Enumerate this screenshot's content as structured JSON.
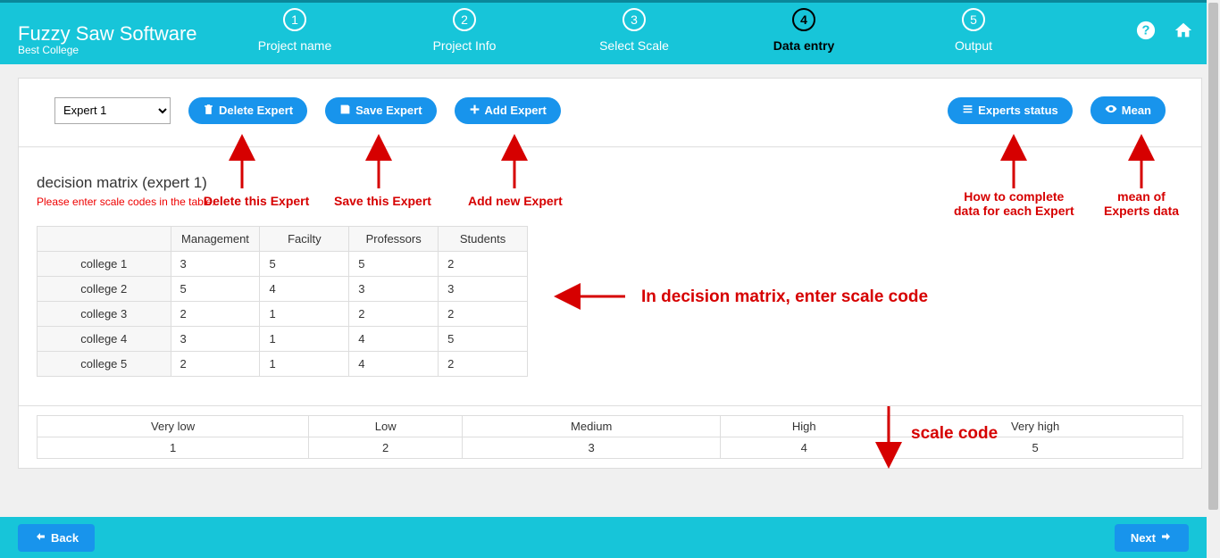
{
  "app": {
    "title": "Fuzzy Saw Software",
    "subtitle": "Best College"
  },
  "steps": [
    {
      "num": "1",
      "label": "Project name"
    },
    {
      "num": "2",
      "label": "Project Info"
    },
    {
      "num": "3",
      "label": "Select Scale"
    },
    {
      "num": "4",
      "label": "Data entry"
    },
    {
      "num": "5",
      "label": "Output"
    }
  ],
  "toolbar": {
    "expert_select": "Expert 1",
    "delete_label": "Delete Expert",
    "save_label": "Save Expert",
    "add_label": "Add Expert",
    "status_label": "Experts status",
    "mean_label": "Mean"
  },
  "matrix": {
    "title": "decision matrix (expert 1)",
    "warning": "Please enter scale codes in the table.",
    "headers": [
      "",
      "Management",
      "Facilty",
      "Professors",
      "Students"
    ],
    "rows": [
      {
        "label": "college 1",
        "vals": [
          "3",
          "5",
          "5",
          "2"
        ]
      },
      {
        "label": "college 2",
        "vals": [
          "5",
          "4",
          "3",
          "3"
        ]
      },
      {
        "label": "college 3",
        "vals": [
          "2",
          "1",
          "2",
          "2"
        ]
      },
      {
        "label": "college 4",
        "vals": [
          "3",
          "1",
          "4",
          "5"
        ]
      },
      {
        "label": "college 5",
        "vals": [
          "2",
          "1",
          "4",
          "2"
        ]
      }
    ]
  },
  "scale": {
    "labels": [
      "Very low",
      "Low",
      "Medium",
      "High",
      "Very high"
    ],
    "codes": [
      "1",
      "2",
      "3",
      "4",
      "5"
    ]
  },
  "footer": {
    "back": "Back",
    "next": "Next"
  },
  "annotations": {
    "delete": "Delete this Expert",
    "save": "Save this Expert",
    "add": "Add new Expert",
    "status": "How to complete\ndata for each Expert",
    "mean": "mean of\nExperts data",
    "matrix_hint": "In decision matrix, enter scale code",
    "scale_hint": "scale code"
  }
}
